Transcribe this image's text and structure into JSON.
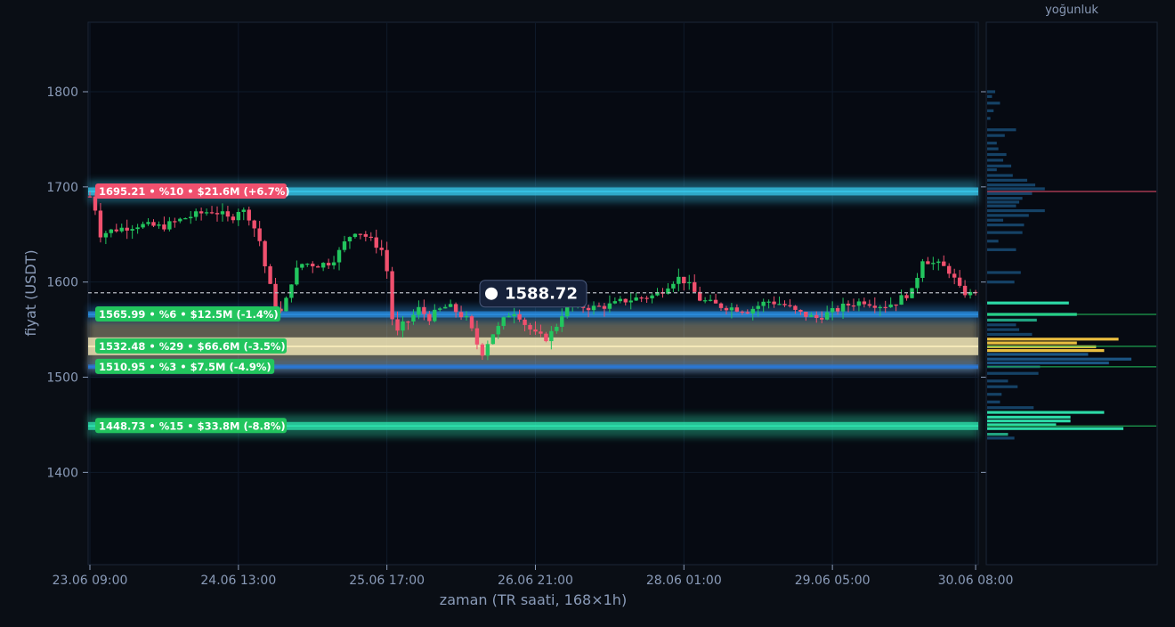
{
  "colors": {
    "page_bg": "#0a0e15",
    "plot_bg": "#060a12",
    "axis_text": "#8a9bb8",
    "grid": "#0f1a2a",
    "up": "#22c55e",
    "down": "#f0506e",
    "current_line": "#b8bcc4",
    "resistance_label": "#f0506e",
    "support_label": "#22c55e"
  },
  "chart_data": {
    "type": "candlestick",
    "xlabel": "zaman (TR saati, 168×1h)",
    "ylabel": "fiyat (USDT)",
    "ylim": [
      1303,
      1873
    ],
    "y_ticks": [
      1400,
      1500,
      1600,
      1700,
      1800
    ],
    "x_ticks": [
      "23.06 09:00",
      "24.06 13:00",
      "25.06 17:00",
      "26.06 21:00",
      "28.06 01:00",
      "29.06 05:00",
      "30.06 08:00"
    ],
    "x_tick_hours": [
      0,
      28,
      56,
      84,
      112,
      140,
      167
    ],
    "bar_count": 168,
    "current_price": 1588.72,
    "current_price_label": "1588.72",
    "price_path": [
      [
        0,
        1690
      ],
      [
        1,
        1680
      ],
      [
        2,
        1650
      ],
      [
        5,
        1655
      ],
      [
        10,
        1660
      ],
      [
        15,
        1658
      ],
      [
        20,
        1668
      ],
      [
        25,
        1675
      ],
      [
        27,
        1672
      ],
      [
        29,
        1665
      ],
      [
        31,
        1678
      ],
      [
        33,
        1668
      ],
      [
        35,
        1645
      ],
      [
        36,
        1620
      ],
      [
        37,
        1600
      ],
      [
        38,
        1580
      ],
      [
        39,
        1565
      ],
      [
        40,
        1572
      ],
      [
        41,
        1588
      ],
      [
        42,
        1608
      ],
      [
        44,
        1620
      ],
      [
        47,
        1618
      ],
      [
        49,
        1620
      ],
      [
        50,
        1622
      ],
      [
        52,
        1635
      ],
      [
        53,
        1645
      ],
      [
        55,
        1655
      ],
      [
        57,
        1648
      ],
      [
        59,
        1640
      ],
      [
        61,
        1630
      ],
      [
        62,
        1580
      ],
      [
        63,
        1540
      ],
      [
        64,
        1552
      ],
      [
        66,
        1560
      ],
      [
        68,
        1572
      ],
      [
        70,
        1562
      ],
      [
        72,
        1570
      ],
      [
        74,
        1575
      ],
      [
        76,
        1568
      ],
      [
        78,
        1560
      ],
      [
        80,
        1535
      ],
      [
        81,
        1525
      ],
      [
        83,
        1545
      ],
      [
        85,
        1555
      ],
      [
        86,
        1565
      ],
      [
        88,
        1570
      ],
      [
        90,
        1555
      ],
      [
        92,
        1545
      ],
      [
        94,
        1540
      ],
      [
        96,
        1550
      ],
      [
        98,
        1572
      ],
      [
        100,
        1575
      ],
      [
        104,
        1573
      ],
      [
        108,
        1576
      ],
      [
        110,
        1580
      ],
      [
        113,
        1583
      ],
      [
        116,
        1585
      ],
      [
        118,
        1590
      ],
      [
        120,
        1600
      ],
      [
        122,
        1605
      ],
      [
        124,
        1595
      ],
      [
        126,
        1582
      ],
      [
        128,
        1578
      ],
      [
        130,
        1575
      ],
      [
        134,
        1572
      ],
      [
        136,
        1570
      ],
      [
        138,
        1575
      ],
      [
        140,
        1580
      ],
      [
        142,
        1578
      ],
      [
        144,
        1575
      ],
      [
        146,
        1568
      ],
      [
        148,
        1565
      ],
      [
        150,
        1562
      ],
      [
        152,
        1566
      ],
      [
        154,
        1570
      ],
      [
        156,
        1575
      ],
      [
        158,
        1578
      ],
      [
        160,
        1580
      ],
      [
        162,
        1577
      ],
      [
        164,
        1575
      ],
      [
        166,
        1578
      ],
      [
        167,
        1580
      ],
      [
        168,
        1585
      ],
      [
        170,
        1590
      ],
      [
        172,
        1625
      ],
      [
        174,
        1620
      ],
      [
        176,
        1617
      ],
      [
        178,
        1610
      ],
      [
        179,
        1598
      ],
      [
        180,
        1590
      ],
      [
        182,
        1587
      ],
      [
        183,
        1588.72
      ]
    ],
    "levels": [
      {
        "price": 1695.21,
        "label": "1695.21 • %10 • $21.6M (+6.7%)",
        "kind": "resistance",
        "band_color": "#38c8ec",
        "band_width": 9
      },
      {
        "price": 1565.99,
        "label": "1565.99 • %6 • $12.5M (-1.4%)",
        "kind": "support",
        "band_color": "#2a8ee0",
        "band_width": 7
      },
      {
        "price": 1532.48,
        "label": "1532.48 • %29 • $66.6M (-3.5%)",
        "kind": "support",
        "band_color": "#fff3c0",
        "band_width": 20
      },
      {
        "price": 1510.95,
        "label": "1510.95 • %3 • $7.5M (-4.9%)",
        "kind": "support",
        "band_color": "#2a78d8",
        "band_width": 5
      },
      {
        "price": 1448.73,
        "label": "1448.73 • %15 • $33.8M (-8.8%)",
        "kind": "support",
        "band_color": "#2ee6b0",
        "band_width": 9
      }
    ],
    "volume_profile": {
      "title": "yoğunluk",
      "bins": [
        [
          1800,
          0.05
        ],
        [
          1795,
          0.03
        ],
        [
          1788,
          0.08
        ],
        [
          1780,
          0.04
        ],
        [
          1772,
          0.02
        ],
        [
          1760,
          0.18
        ],
        [
          1754,
          0.11
        ],
        [
          1746,
          0.06
        ],
        [
          1740,
          0.07
        ],
        [
          1734,
          0.12
        ],
        [
          1728,
          0.1
        ],
        [
          1722,
          0.15
        ],
        [
          1718,
          0.06
        ],
        [
          1712,
          0.16
        ],
        [
          1707,
          0.25
        ],
        [
          1702,
          0.3
        ],
        [
          1698,
          0.36
        ],
        [
          1693,
          0.28
        ],
        [
          1688,
          0.22
        ],
        [
          1684,
          0.2
        ],
        [
          1680,
          0.18
        ],
        [
          1675,
          0.36
        ],
        [
          1670,
          0.26
        ],
        [
          1665,
          0.1
        ],
        [
          1660,
          0.23
        ],
        [
          1652,
          0.22
        ],
        [
          1643,
          0.07
        ],
        [
          1634,
          0.18
        ],
        [
          1610,
          0.21
        ],
        [
          1600,
          0.17
        ],
        [
          1578,
          0.51
        ],
        [
          1566,
          0.56
        ],
        [
          1560,
          0.31
        ],
        [
          1555,
          0.18
        ],
        [
          1550,
          0.2
        ],
        [
          1545,
          0.28
        ],
        [
          1540,
          0.82
        ],
        [
          1536,
          0.56
        ],
        [
          1532,
          0.68
        ],
        [
          1528,
          0.73
        ],
        [
          1524,
          0.63
        ],
        [
          1519,
          0.9
        ],
        [
          1515,
          0.76
        ],
        [
          1511,
          0.33
        ],
        [
          1504,
          0.32
        ],
        [
          1496,
          0.13
        ],
        [
          1490,
          0.19
        ],
        [
          1482,
          0.09
        ],
        [
          1474,
          0.08
        ],
        [
          1468,
          0.29
        ],
        [
          1463,
          0.73
        ],
        [
          1458,
          0.52
        ],
        [
          1454,
          0.52
        ],
        [
          1450,
          0.43
        ],
        [
          1446,
          0.85
        ],
        [
          1440,
          0.13
        ],
        [
          1436,
          0.17
        ]
      ]
    }
  }
}
